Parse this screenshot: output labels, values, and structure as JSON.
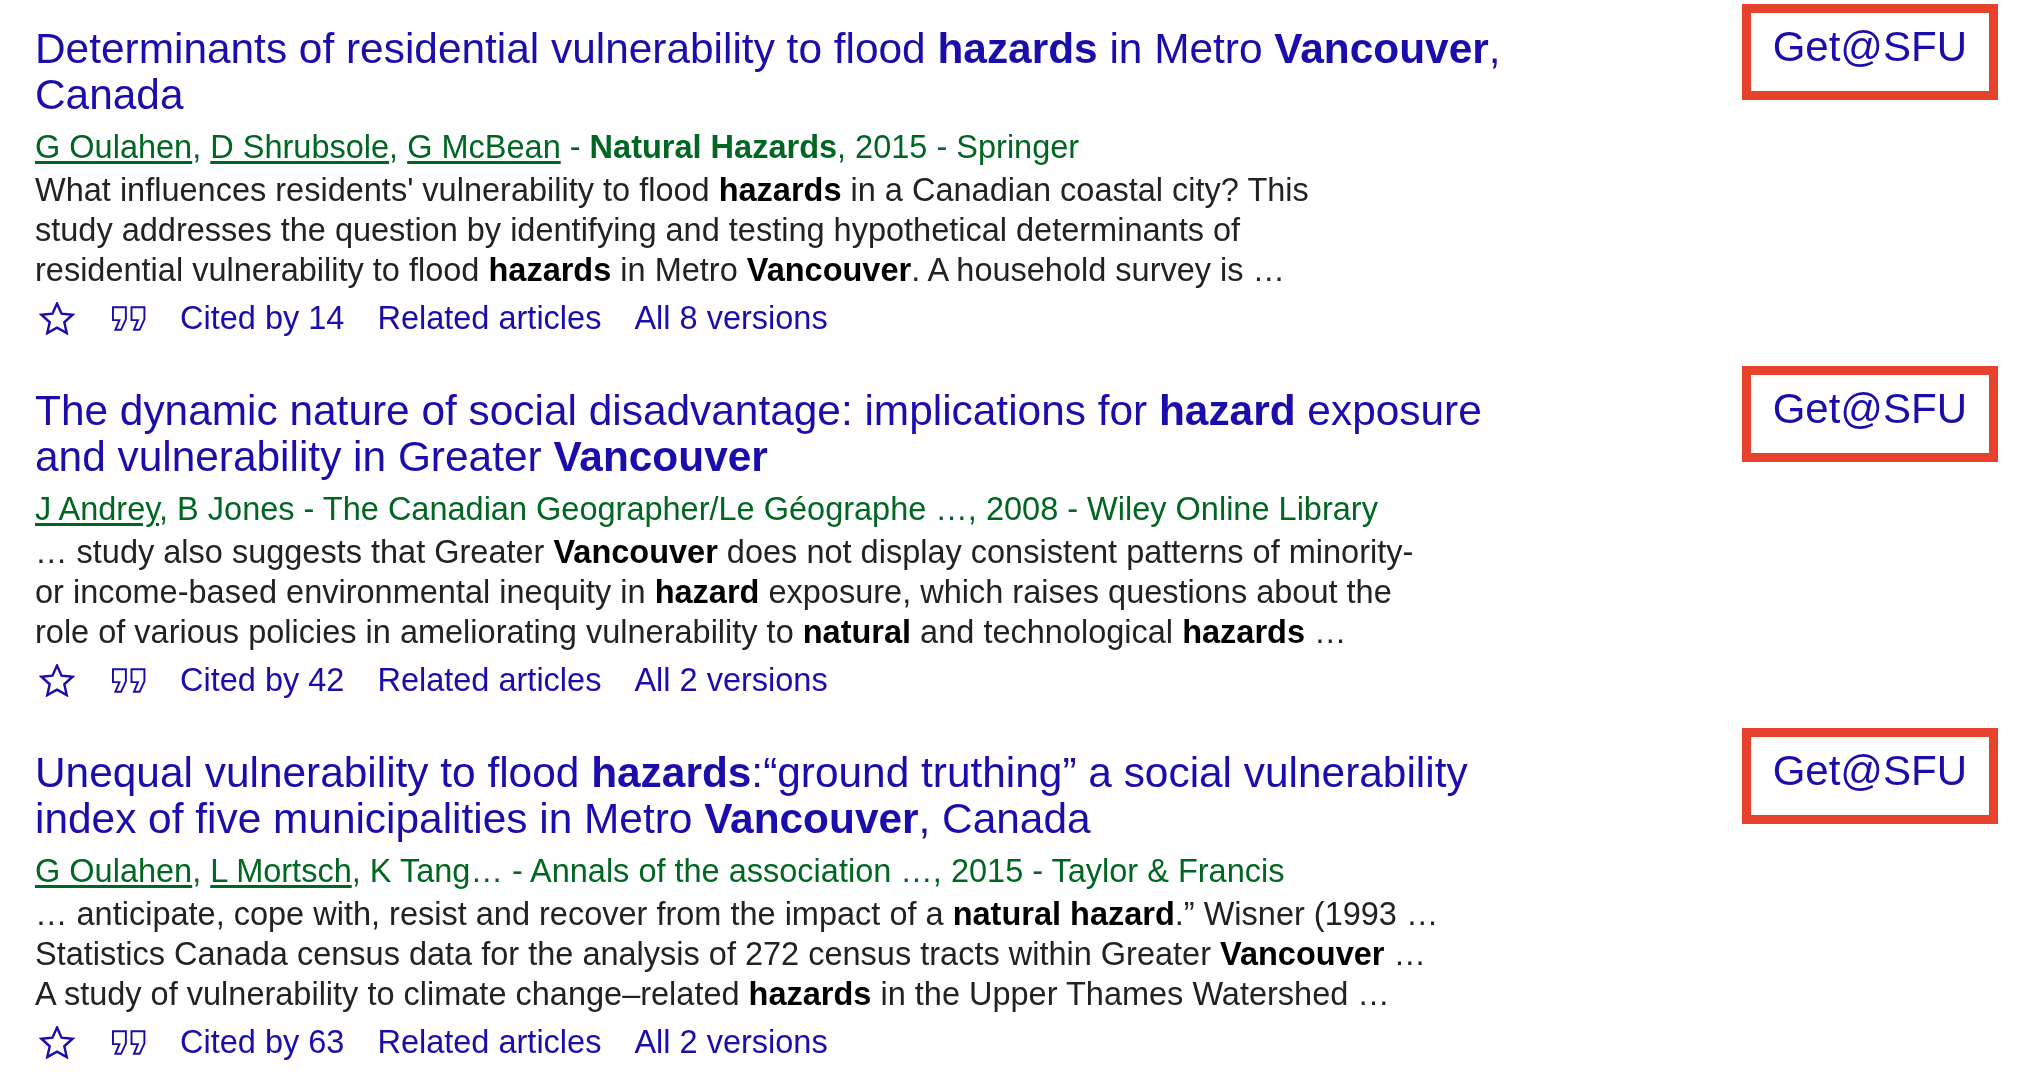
{
  "results": [
    {
      "title": "Determinants of residential vulnerability to flood **hazards** in Metro **Vancouver**, Canada",
      "authors": [
        {
          "name": "G Oulahen",
          "separator": ", "
        },
        {
          "name": "D Shrubsole",
          "separator": ", "
        },
        {
          "name": "G McBean"
        }
      ],
      "source": " - **Natural Hazards**, 2015 - Springer",
      "snippet": [
        "What influences residents' vulnerability to flood **hazards** in a Canadian coastal city? This",
        "study addresses the question by identifying and testing hypothetical determinants of",
        "residential vulnerability to flood **hazards** in Metro **Vancouver**. A household survey is …"
      ],
      "links": [
        "Cited by 14",
        "Related articles",
        "All 8 versions"
      ],
      "library_link": {
        "label": "Get@SFU",
        "highlighted": true
      }
    },
    {
      "title": "The dynamic nature of social disadvantage: implications for **hazard** exposure and vulnerability in Greater **Vancouver**",
      "authors": [
        {
          "name": "J Andrey"
        }
      ],
      "source": ", B Jones - The Canadian Geographer/Le Géographe …, 2008 - Wiley Online Library",
      "snippet": [
        "… study also suggests that Greater **Vancouver** does not display consistent patterns of minority-",
        "or income-based environmental inequity in **hazard** exposure, which raises questions about the",
        "role of various policies in ameliorating vulnerability to **natural** and technological **hazards** …"
      ],
      "links": [
        "Cited by 42",
        "Related articles",
        "All 2 versions"
      ],
      "library_link": {
        "label": "Get@SFU",
        "highlighted": true
      }
    },
    {
      "title": "Unequal vulnerability to flood **hazards**:“ground truthing” a social vulnerability index of five municipalities in Metro **Vancouver**, Canada",
      "authors": [
        {
          "name": "G Oulahen",
          "separator": ", "
        },
        {
          "name": "L Mortsch"
        }
      ],
      "source": ", K Tang… - Annals of the association …, 2015 - Taylor & Francis",
      "snippet": [
        "… anticipate, cope with, resist and recover from the impact of a **natural hazard**.” Wisner (1993 …",
        "Statistics Canada census data for the analysis of 272 census tracts within Greater **Vancouver** …",
        "A study of vulnerability to climate change–related **hazards** in the Upper Thames Watershed …"
      ],
      "links": [
        "Cited by 63",
        "Related articles",
        "All 2 versions"
      ],
      "library_link": {
        "label": "Get@SFU",
        "highlighted": true
      }
    }
  ]
}
